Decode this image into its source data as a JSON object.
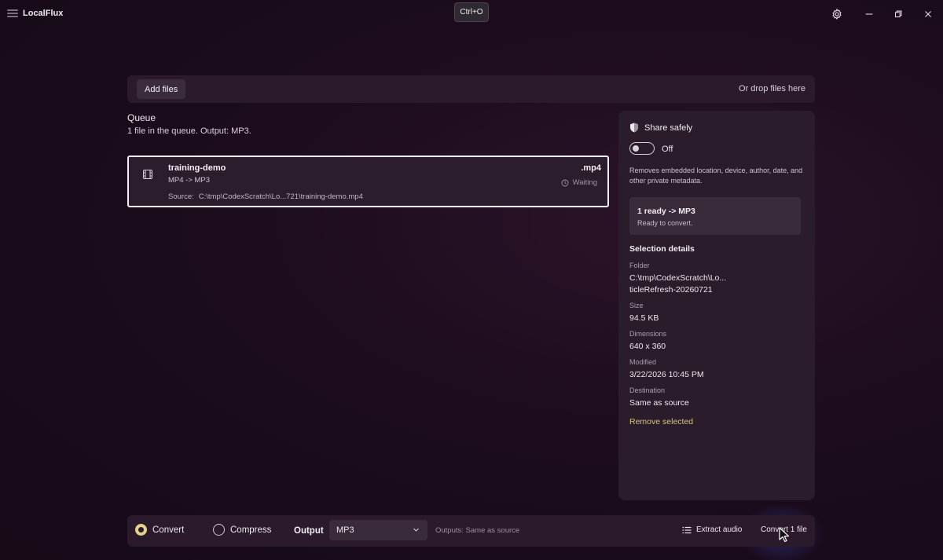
{
  "window": {
    "app_title": "LocalFlux",
    "shortcut_hint": "Ctrl+O",
    "icons": [
      "settings-icon",
      "minimize-icon",
      "restore-icon",
      "close-icon"
    ]
  },
  "dropzone": {
    "add_files_label": "Add files",
    "drop_hint": "Or drop files here"
  },
  "queue": {
    "title": "Queue",
    "summary": "1 file in the queue. Output: MP3.",
    "items": [
      {
        "name": "training-demo",
        "conversion": "MP4 -> MP3",
        "source_label": "Source:",
        "source_path": "C:\\tmp\\CodexScratch\\Lo...721\\training-demo.mp4",
        "extension": ".mp4",
        "status": "Waiting",
        "icon": "film-icon"
      }
    ]
  },
  "side_panel": {
    "share_title": "Share safely",
    "share_toggle": {
      "label": "Off",
      "state": "off"
    },
    "share_description": "Removes embedded location, device, author, date, and other private metadata.",
    "ready": {
      "title": "1 ready -> MP3",
      "subtitle": "Ready to convert."
    },
    "details_title": "Selection details",
    "details": {
      "folder_label": "Folder",
      "folder_value_line1": "C:\\tmp\\CodexScratch\\Lo...",
      "folder_value_line2": "ticleRefresh-20260721",
      "size_label": "Size",
      "size_value": "94.5 KB",
      "dimensions_label": "Dimensions",
      "dimensions_value": "640 x 360",
      "modified_label": "Modified",
      "modified_value": "3/22/2026 10:45 PM",
      "destination_label": "Destination",
      "destination_value": "Same as source"
    },
    "remove_label": "Remove selected"
  },
  "bottom_bar": {
    "mode_convert": "Convert",
    "mode_compress": "Compress",
    "selected_mode": "Convert",
    "output_label": "Output",
    "output_value": "MP3",
    "outputs_note": "Outputs: Same as source",
    "extract_audio_label": "Extract audio",
    "convert_label": "Convert 1 file"
  },
  "colors": {
    "background": "#1c0c1d",
    "panel": "#2a1a2b",
    "accent": "#e4d28a",
    "link": "#d9c27a"
  }
}
